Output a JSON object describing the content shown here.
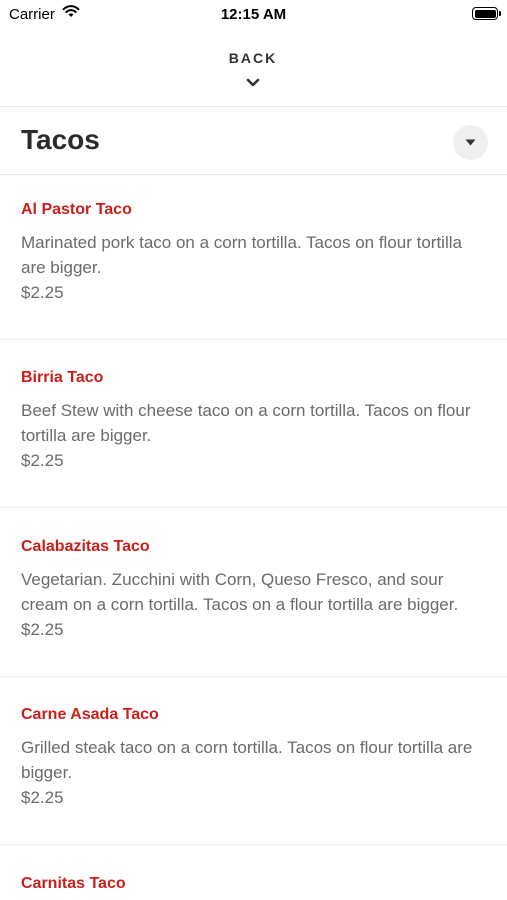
{
  "status_bar": {
    "carrier": "Carrier",
    "time": "12:15 AM",
    "wifi_icon": "wifi-icon",
    "battery_icon": "battery-icon"
  },
  "nav": {
    "back_label": "BACK",
    "back_icon": "chevron-down-icon"
  },
  "section": {
    "title": "Tacos",
    "dropdown_icon": "caret-down-icon"
  },
  "colors": {
    "item_name": "#cc1f1a",
    "body_text": "#6b6b6b",
    "title_text": "#2b2b2b",
    "divider": "#ececec"
  },
  "items": [
    {
      "name": "Al Pastor Taco",
      "description": "Marinated pork taco on a corn tortilla. Tacos on flour tortilla are bigger.",
      "price": "$2.25"
    },
    {
      "name": "Birria Taco",
      "description": "Beef Stew with cheese taco on a corn tortilla. Tacos on flour tortilla are bigger.",
      "price": "$2.25"
    },
    {
      "name": "Calabazitas Taco",
      "description": "Vegetarian. Zucchini with Corn, Queso Fresco, and sour cream on a corn tortilla. Tacos on a flour tortilla are bigger.",
      "price": "$2.25"
    },
    {
      "name": "Carne Asada Taco",
      "description": "Grilled steak taco on a corn tortilla. Tacos on flour tortilla are bigger.",
      "price": "$2.25"
    },
    {
      "name": "Carnitas Taco"
    }
  ]
}
